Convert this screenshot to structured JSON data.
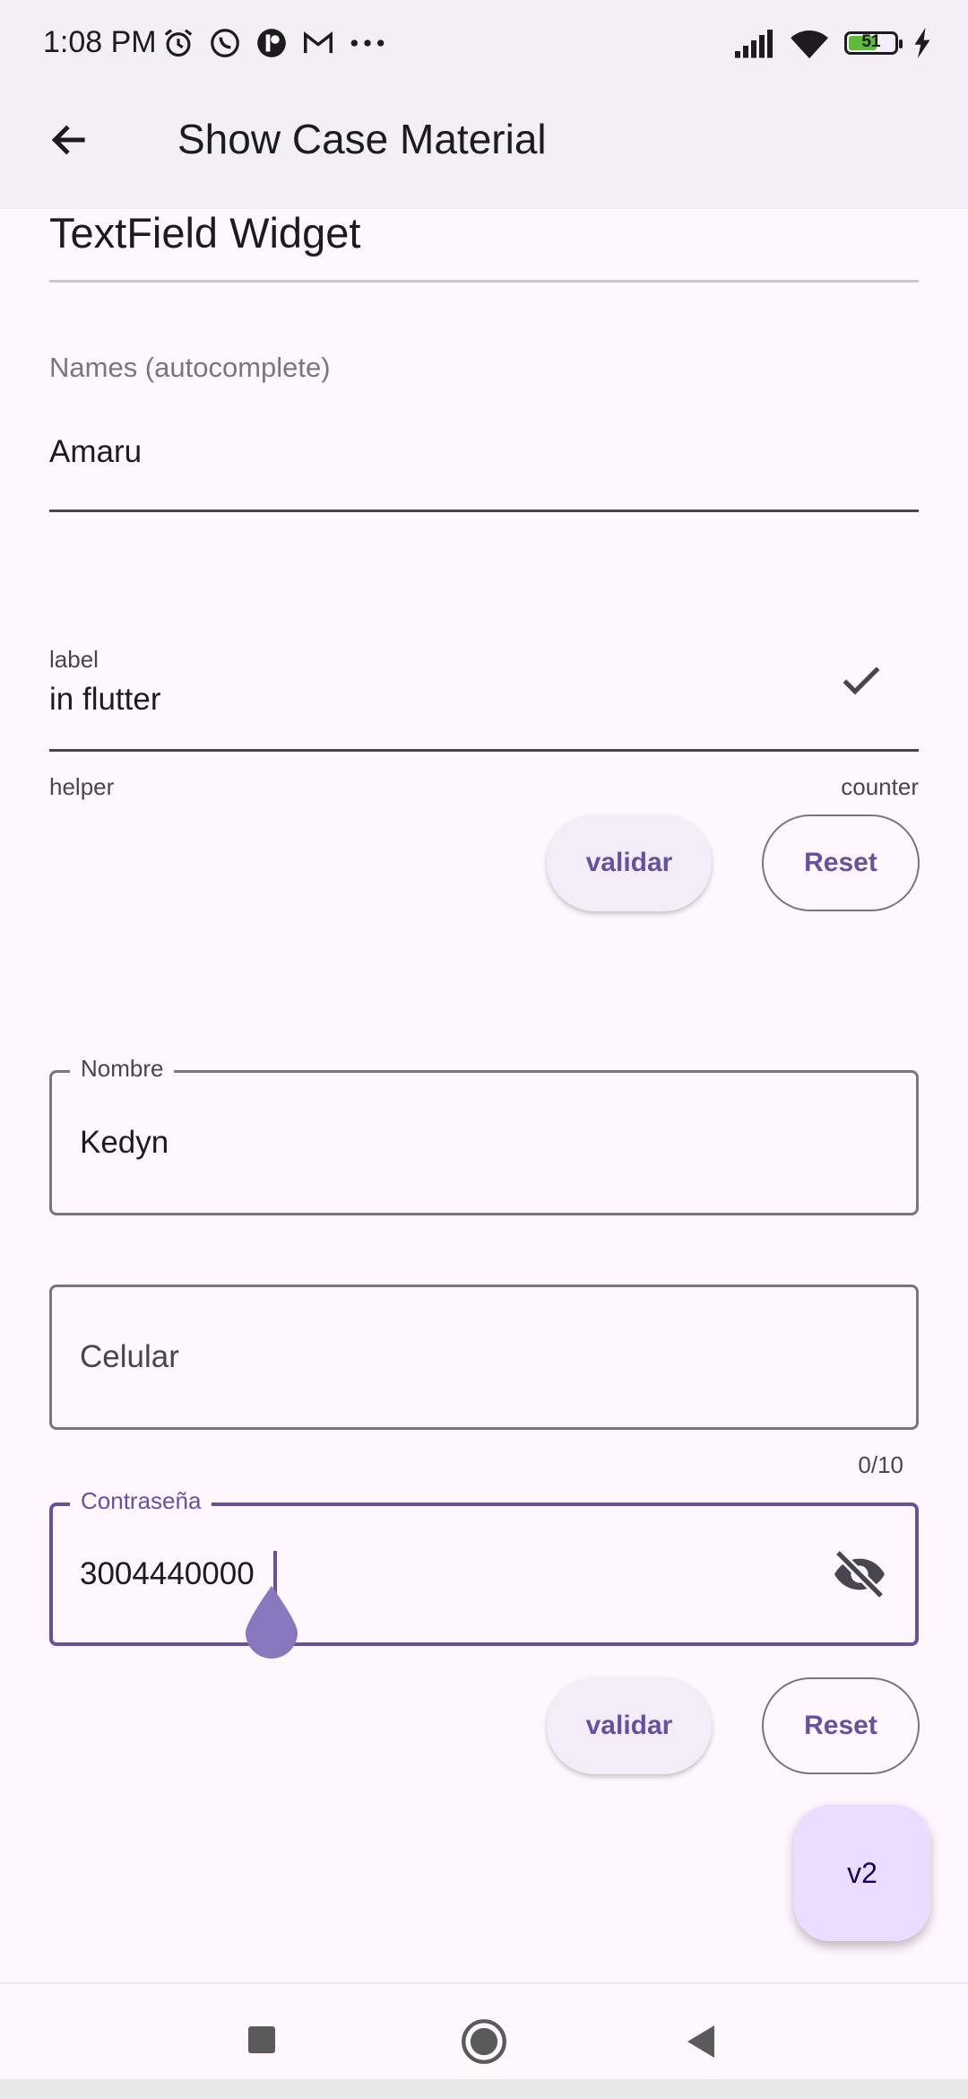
{
  "status_bar": {
    "time": "1:08 PM",
    "battery_level": "51",
    "icons_left": [
      "alarm-icon",
      "whatsapp-icon",
      "app-icon",
      "gmail-icon",
      "more-dots-icon"
    ],
    "icons_right": [
      "signal-icon",
      "wifi-icon",
      "battery-icon",
      "charging-icon"
    ]
  },
  "app_bar": {
    "title": "Show Case Material",
    "back_icon": "arrow-back-icon"
  },
  "section": {
    "title": "TextField Widget"
  },
  "names_field": {
    "label": "Names (autocomplete)",
    "value": "Amaru"
  },
  "label_field": {
    "label": "label",
    "value": "in flutter",
    "helper": "helper",
    "counter": "counter",
    "suffix_icon": "check-icon"
  },
  "form1_buttons": {
    "validate": "validar",
    "reset": "Reset"
  },
  "nombre_field": {
    "label": "Nombre",
    "value": "Kedyn"
  },
  "celular_field": {
    "placeholder": "Celular",
    "counter": "0/10"
  },
  "password_field": {
    "label": "Contraseña",
    "value": "3004440000",
    "suffix_icon": "visibility-off-icon"
  },
  "form2_buttons": {
    "validate": "validar",
    "reset": "Reset"
  },
  "fab": {
    "label": "v2"
  },
  "nav_bar": {
    "icons": [
      "square-recents-icon",
      "circle-home-icon",
      "triangle-back-icon"
    ]
  },
  "colors": {
    "primary": "#6750A4",
    "background": "#FEF7FE",
    "outline": "#79747E",
    "fab": "#EADDFF"
  }
}
